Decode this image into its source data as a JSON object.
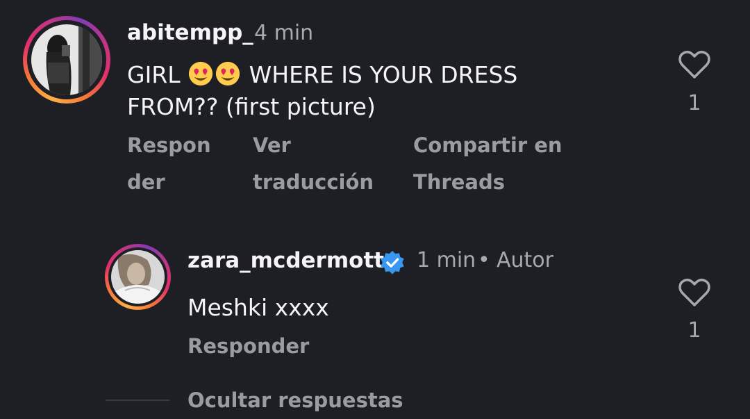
{
  "comment1": {
    "username": "abitempp_",
    "time": "4 min",
    "text_before": "GIRL",
    "emojis": [
      "heart-eyes-emoji",
      "heart-eyes-emoji"
    ],
    "text_after": "WHERE IS YOUR DRESS",
    "text_line2": "FROM?? (first picture)",
    "like_count": "1",
    "actions": {
      "reply_l1": "Respon",
      "reply_l2": "der",
      "translate_l1": "Ver",
      "translate_l2": "traducción",
      "share_l1": "Compartir en",
      "share_l2": "Threads"
    }
  },
  "comment2": {
    "username": "zara_mcdermott",
    "time": "1 min",
    "separator": "•",
    "author_label": "Autor",
    "text": "Meshki xxxx",
    "like_count": "1",
    "reply": "Responder",
    "hide_replies": "Ocultar respuestas"
  },
  "colors": {
    "background": "#1e1f24",
    "verified": "#3897f0",
    "muted_text": "#9a9ca4"
  },
  "icons": [
    "heart-icon",
    "verified-badge-icon",
    "heart-eyes-emoji"
  ]
}
